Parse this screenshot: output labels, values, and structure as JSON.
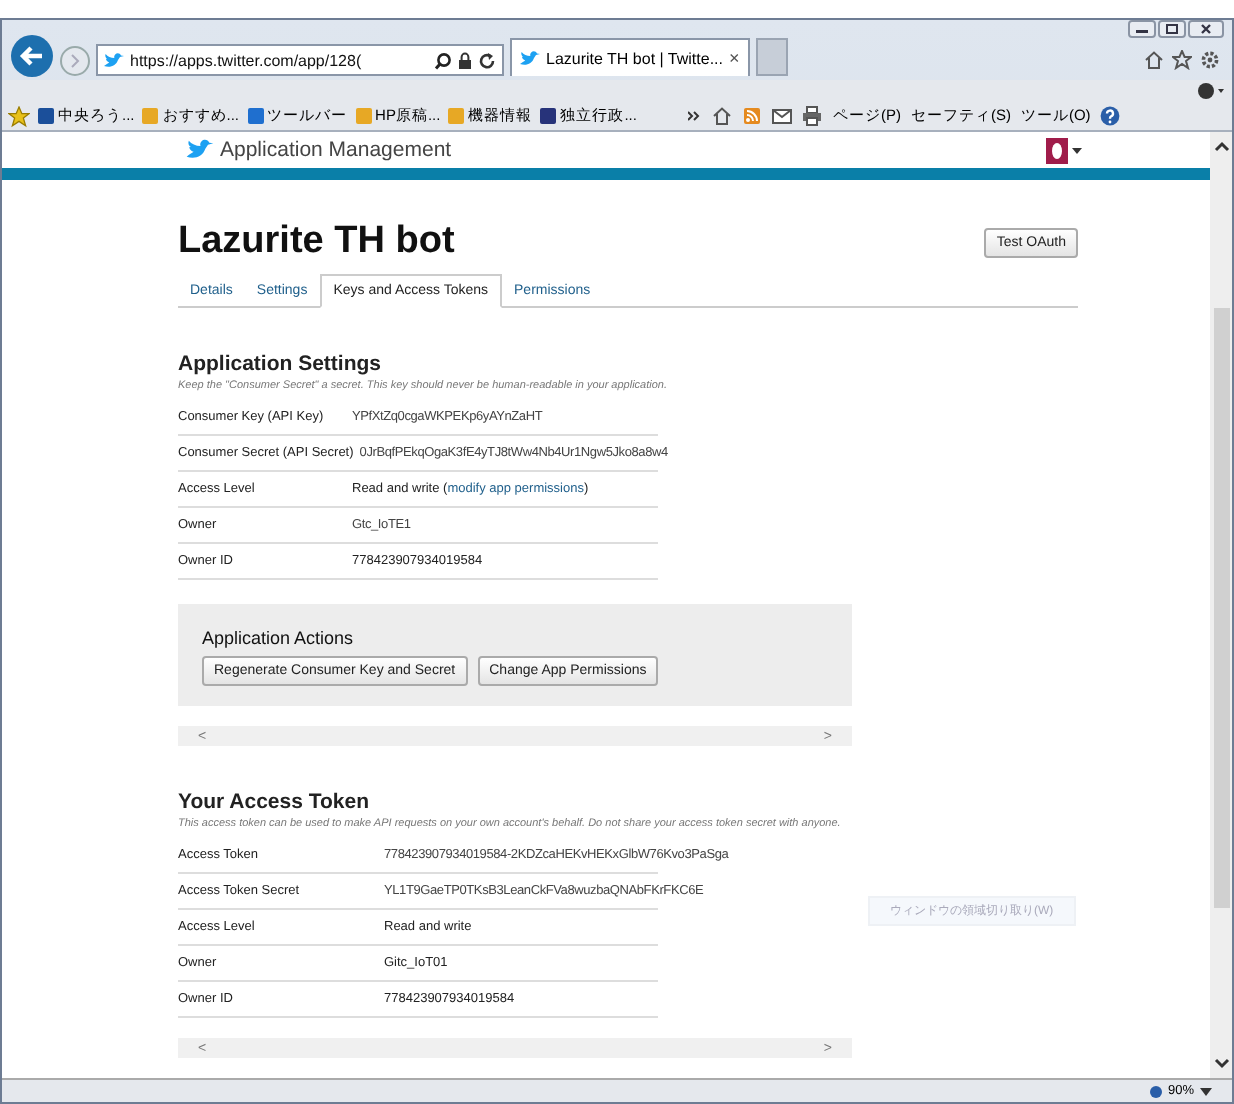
{
  "browser": {
    "address": "https://apps.twitter.com/app/128(",
    "tab_title": "Lazurite TH bot | Twitte...",
    "tab_close": "×",
    "favorites": [
      "中央ろう...",
      "おすすめ...",
      "ツールバー",
      "HP原稿...",
      "機器情報",
      "独立行政..."
    ],
    "commands": [
      "ページ(P)",
      "セーフティ(S)",
      "ツール(O)"
    ],
    "zoom": "90%"
  },
  "header": {
    "brand": "Application Management"
  },
  "app": {
    "title": "Lazurite TH bot",
    "test_button": "Test OAuth",
    "tabs": [
      {
        "label": "Details",
        "selected": false
      },
      {
        "label": "Settings",
        "selected": false
      },
      {
        "label": "Keys and Access Tokens",
        "selected": true
      },
      {
        "label": "Permissions",
        "selected": false
      }
    ]
  },
  "settings": {
    "heading": "Application Settings",
    "note": "Keep the \"Consumer Secret\" a secret. This key should never be human-readable in your application.",
    "rows": [
      {
        "label": "Consumer Key (API Key)",
        "value": "YPfXtZq0cgaWKPEKp6yAYnZaHT",
        "kind": "secret"
      },
      {
        "label": "Consumer Secret (API Secret)",
        "value": "0JrBqfPEkqOgaK3fE4yTJ8tWw4Nb4Ur1Ngw5Jko8a8w4",
        "kind": "secret"
      },
      {
        "label": "Access Level",
        "value": "Read and write (",
        "link": "modify app permissions",
        "value_end": ")",
        "kind": "plain"
      },
      {
        "label": "Owner",
        "value": "Gtc_IoTE1",
        "kind": "secret"
      },
      {
        "label": "Owner ID",
        "value": "778423907934019584",
        "kind": "plain"
      }
    ]
  },
  "actions": {
    "heading": "Application Actions",
    "buttons": [
      "Regenerate Consumer Key and Secret",
      "Change App Permissions"
    ],
    "scroll_left": "<",
    "scroll_right": ">"
  },
  "token": {
    "heading": "Your Access Token",
    "note": "This access token can be used to make API requests on your own account's behalf. Do not share your access token secret with anyone.",
    "rows": [
      {
        "label": "Access Token",
        "value": "778423907934019584-2KDZcaHEKvHEKxGlbW76Kvo3PaSga",
        "kind": "secret"
      },
      {
        "label": "Access Token Secret",
        "value": "YL1T9GaeTP0TKsB3LeanCkFVa8wuzbaQNAbFKrFKC6E",
        "kind": "secret"
      },
      {
        "label": "Access Level",
        "value": "Read and write",
        "kind": "plain"
      },
      {
        "label": "Owner",
        "value": "Gitc_IoT01",
        "kind": "plain"
      },
      {
        "label": "Owner ID",
        "value": "778423907934019584",
        "kind": "plain"
      }
    ],
    "scroll_left": "<",
    "scroll_right": ">"
  },
  "tooltip": "ウィンドウの領域切り取り(W)"
}
